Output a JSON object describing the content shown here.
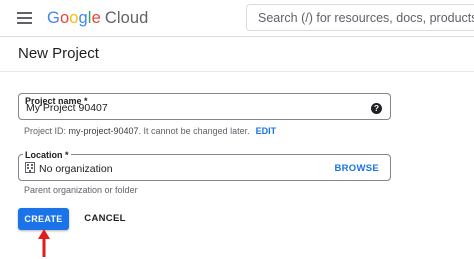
{
  "header": {
    "menu_icon": "hamburger-menu-icon",
    "logo": {
      "g1": "G",
      "o1": "o",
      "o2": "o",
      "g2": "g",
      "l": "l",
      "e": "e",
      "product": "Cloud"
    },
    "search_placeholder": "Search (/) for resources, docs, products, an"
  },
  "page": {
    "title": "New Project"
  },
  "project_name": {
    "label": "Project name *",
    "value": "My Project 90407",
    "help_icon": "help-circle-icon",
    "hint_prefix": "Project ID: ",
    "hint_id": "my-project-90407",
    "hint_suffix": ". It cannot be changed later.",
    "edit_label": "EDIT"
  },
  "location": {
    "label": "Location *",
    "icon": "building-icon",
    "value": "No organization",
    "browse_label": "BROWSE",
    "hint": "Parent organization or folder"
  },
  "actions": {
    "create_label": "CREATE",
    "cancel_label": "CANCEL"
  },
  "annotation": {
    "arrow_color": "#e21b1b",
    "primary_color": "#1a73e8"
  }
}
